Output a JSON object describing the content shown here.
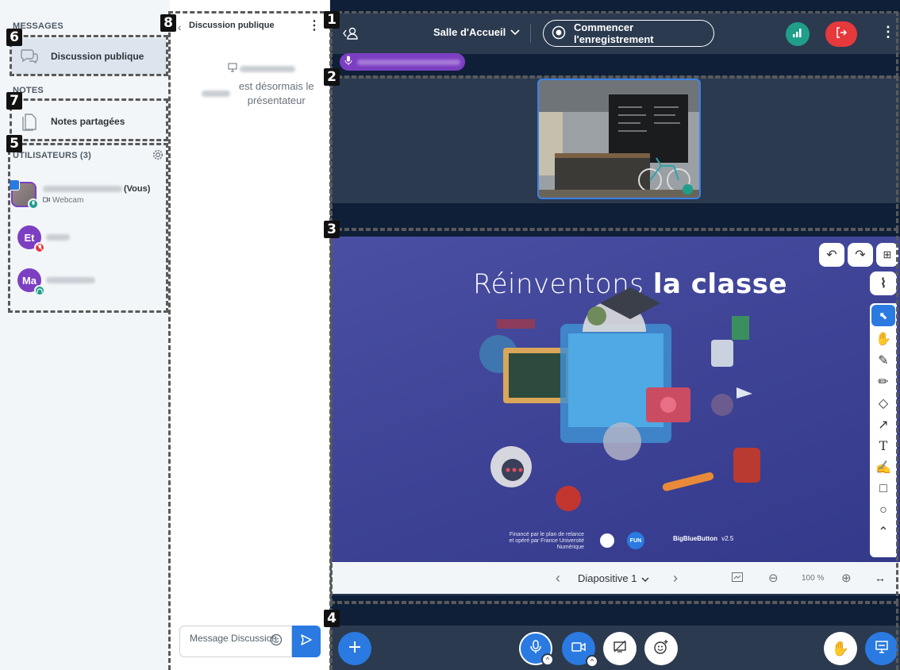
{
  "sidebar": {
    "messages_title": "MESSAGES",
    "public_chat_label": "Discussion publique",
    "notes_title": "NOTES",
    "shared_notes_label": "Notes partagées",
    "users_title": "UTILISATEURS (3)",
    "users": [
      {
        "initials": "",
        "suffix": "(Vous)",
        "sub": "Webcam",
        "avatar_color": "#7c3fc2",
        "badge_color": "#1f9e8a"
      },
      {
        "initials": "Et",
        "suffix": "",
        "sub": "",
        "avatar_color": "#7c3fc2",
        "badge_color": "#e5393c"
      },
      {
        "initials": "Ma",
        "suffix": "",
        "sub": "",
        "avatar_color": "#7c3fc2",
        "badge_color": "#1f9e8a"
      }
    ]
  },
  "chat": {
    "header": "Discussion publique",
    "message_tail": "est désormais le présentateur",
    "input_placeholder": "Message Discussion"
  },
  "topbar": {
    "room": "Salle d'Accueil",
    "record_label": "Commencer l'enregistrement",
    "connection_color": "#1f9e8a",
    "leave_color": "#e5393c"
  },
  "slide": {
    "title_light": "Réinventons",
    "title_bold": "la classe",
    "footer_text": "Financé par le plan de relance et opéré par France Université Numérique",
    "fun_label": "FUN",
    "bbb_label": "BigBlueButton",
    "version": "v2.5"
  },
  "slide_nav": {
    "slide_label": "Diapositive 1",
    "zoom": "100 %"
  },
  "annotations": [
    "1",
    "2",
    "3",
    "4",
    "5",
    "6",
    "7",
    "8"
  ]
}
